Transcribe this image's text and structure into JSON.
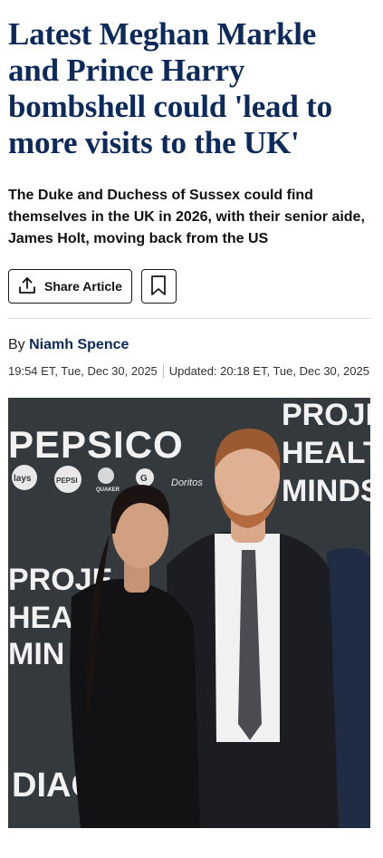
{
  "article": {
    "headline": "Latest Meghan Markle and Prince Harry bombshell could 'lead to more visits to the UK'",
    "standfirst": "The Duke and Duchess of Sussex could find themselves in the UK in 2026, with their senior aide, James Holt, moving back from the US",
    "share_label": "Share Article",
    "byline_prefix": "By",
    "author": "Niamh Spence",
    "published": "19:54 ET, Tue, Dec 30, 2025",
    "updated": "Updated: 20:18 ET, Tue, Dec 30, 2025"
  },
  "hero": {
    "backdrop_brand": "PEPSICO",
    "backdrop_logos": [
      "lays",
      "PEPSI",
      "QUAKER",
      "G",
      "Doritos"
    ],
    "backdrop_text_right": [
      "PROJE",
      "HEALT",
      "MINDS"
    ],
    "backdrop_text_left": [
      "PROJE",
      "HEAL",
      "MIN"
    ],
    "backdrop_text_bottom": "DIAG"
  },
  "colors": {
    "headline": "#0c2a5b",
    "author": "#0c2a5b",
    "backdrop": "#2f3437"
  },
  "icons": [
    "share-icon",
    "bookmark-icon"
  ]
}
